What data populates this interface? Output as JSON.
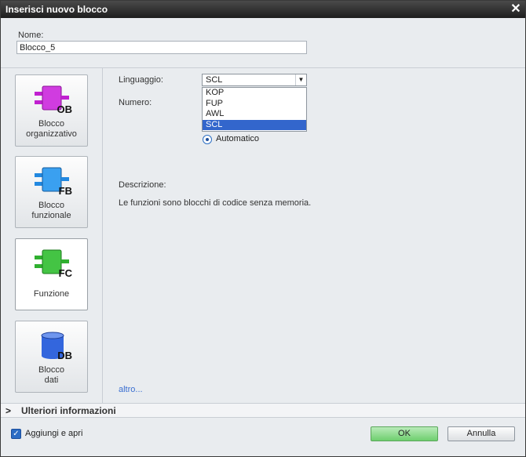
{
  "dialog": {
    "title": "Inserisci nuovo blocco",
    "close_glyph": "✕"
  },
  "name": {
    "label": "Nome:",
    "value": "Blocco_5"
  },
  "blocks": [
    {
      "code": "OB",
      "label": "Blocco\norganizzativo",
      "icon": "organization-block-icon",
      "color": "#c020d0"
    },
    {
      "code": "FB",
      "label": "Blocco\nfunzionale",
      "icon": "function-block-icon",
      "color": "#2288e0"
    },
    {
      "code": "FC",
      "label": "Funzione",
      "icon": "function-icon",
      "color": "#30b030"
    },
    {
      "code": "DB",
      "label": "Blocco\ndati",
      "icon": "data-block-icon",
      "color": "#3366dd"
    }
  ],
  "selected_block": "FC",
  "language": {
    "label": "Linguaggio:",
    "value": "SCL",
    "options": [
      "KOP",
      "FUP",
      "AWL",
      "SCL"
    ]
  },
  "number": {
    "label": "Numero:",
    "mode_label": "Automatico"
  },
  "description": {
    "label": "Descrizione:",
    "text": "Le funzioni sono blocchi di codice senza memoria."
  },
  "more_link": "altro...",
  "more_info": {
    "chevron": ">",
    "label": "Ulteriori informazioni"
  },
  "footer": {
    "add_open_label": "Aggiungi e apri",
    "add_open_checked": true,
    "ok_label": "OK",
    "cancel_label": "Annulla"
  }
}
